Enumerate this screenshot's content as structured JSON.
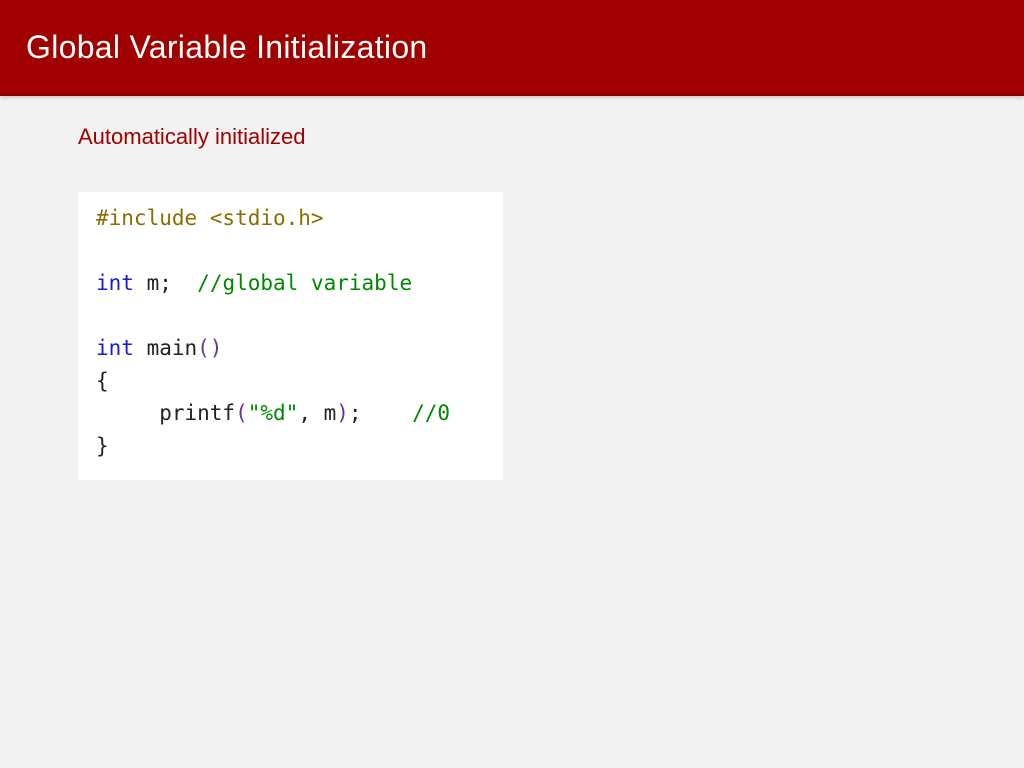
{
  "header": {
    "title": "Global Variable Initialization"
  },
  "subtitle": "Automatically initialized",
  "code": {
    "l1_preproc": "#include <stdio.h>",
    "l2_empty": " ",
    "l3_kw": "int",
    "l3_var": " m;",
    "l3_pad": "  ",
    "l3_comment": "//global variable",
    "l4_empty": " ",
    "l5_kw": "int",
    "l5_fn": " main",
    "l5_paren": "()",
    "l6_brace": "{",
    "l7_pad": "     ",
    "l7_fn": "printf",
    "l7_open": "(",
    "l7_str": "\"%d\"",
    "l7_args": ", m",
    "l7_close": ")",
    "l7_semi": ";",
    "l7_pad2": "    ",
    "l7_comment": "//0",
    "l8_brace": "}"
  }
}
